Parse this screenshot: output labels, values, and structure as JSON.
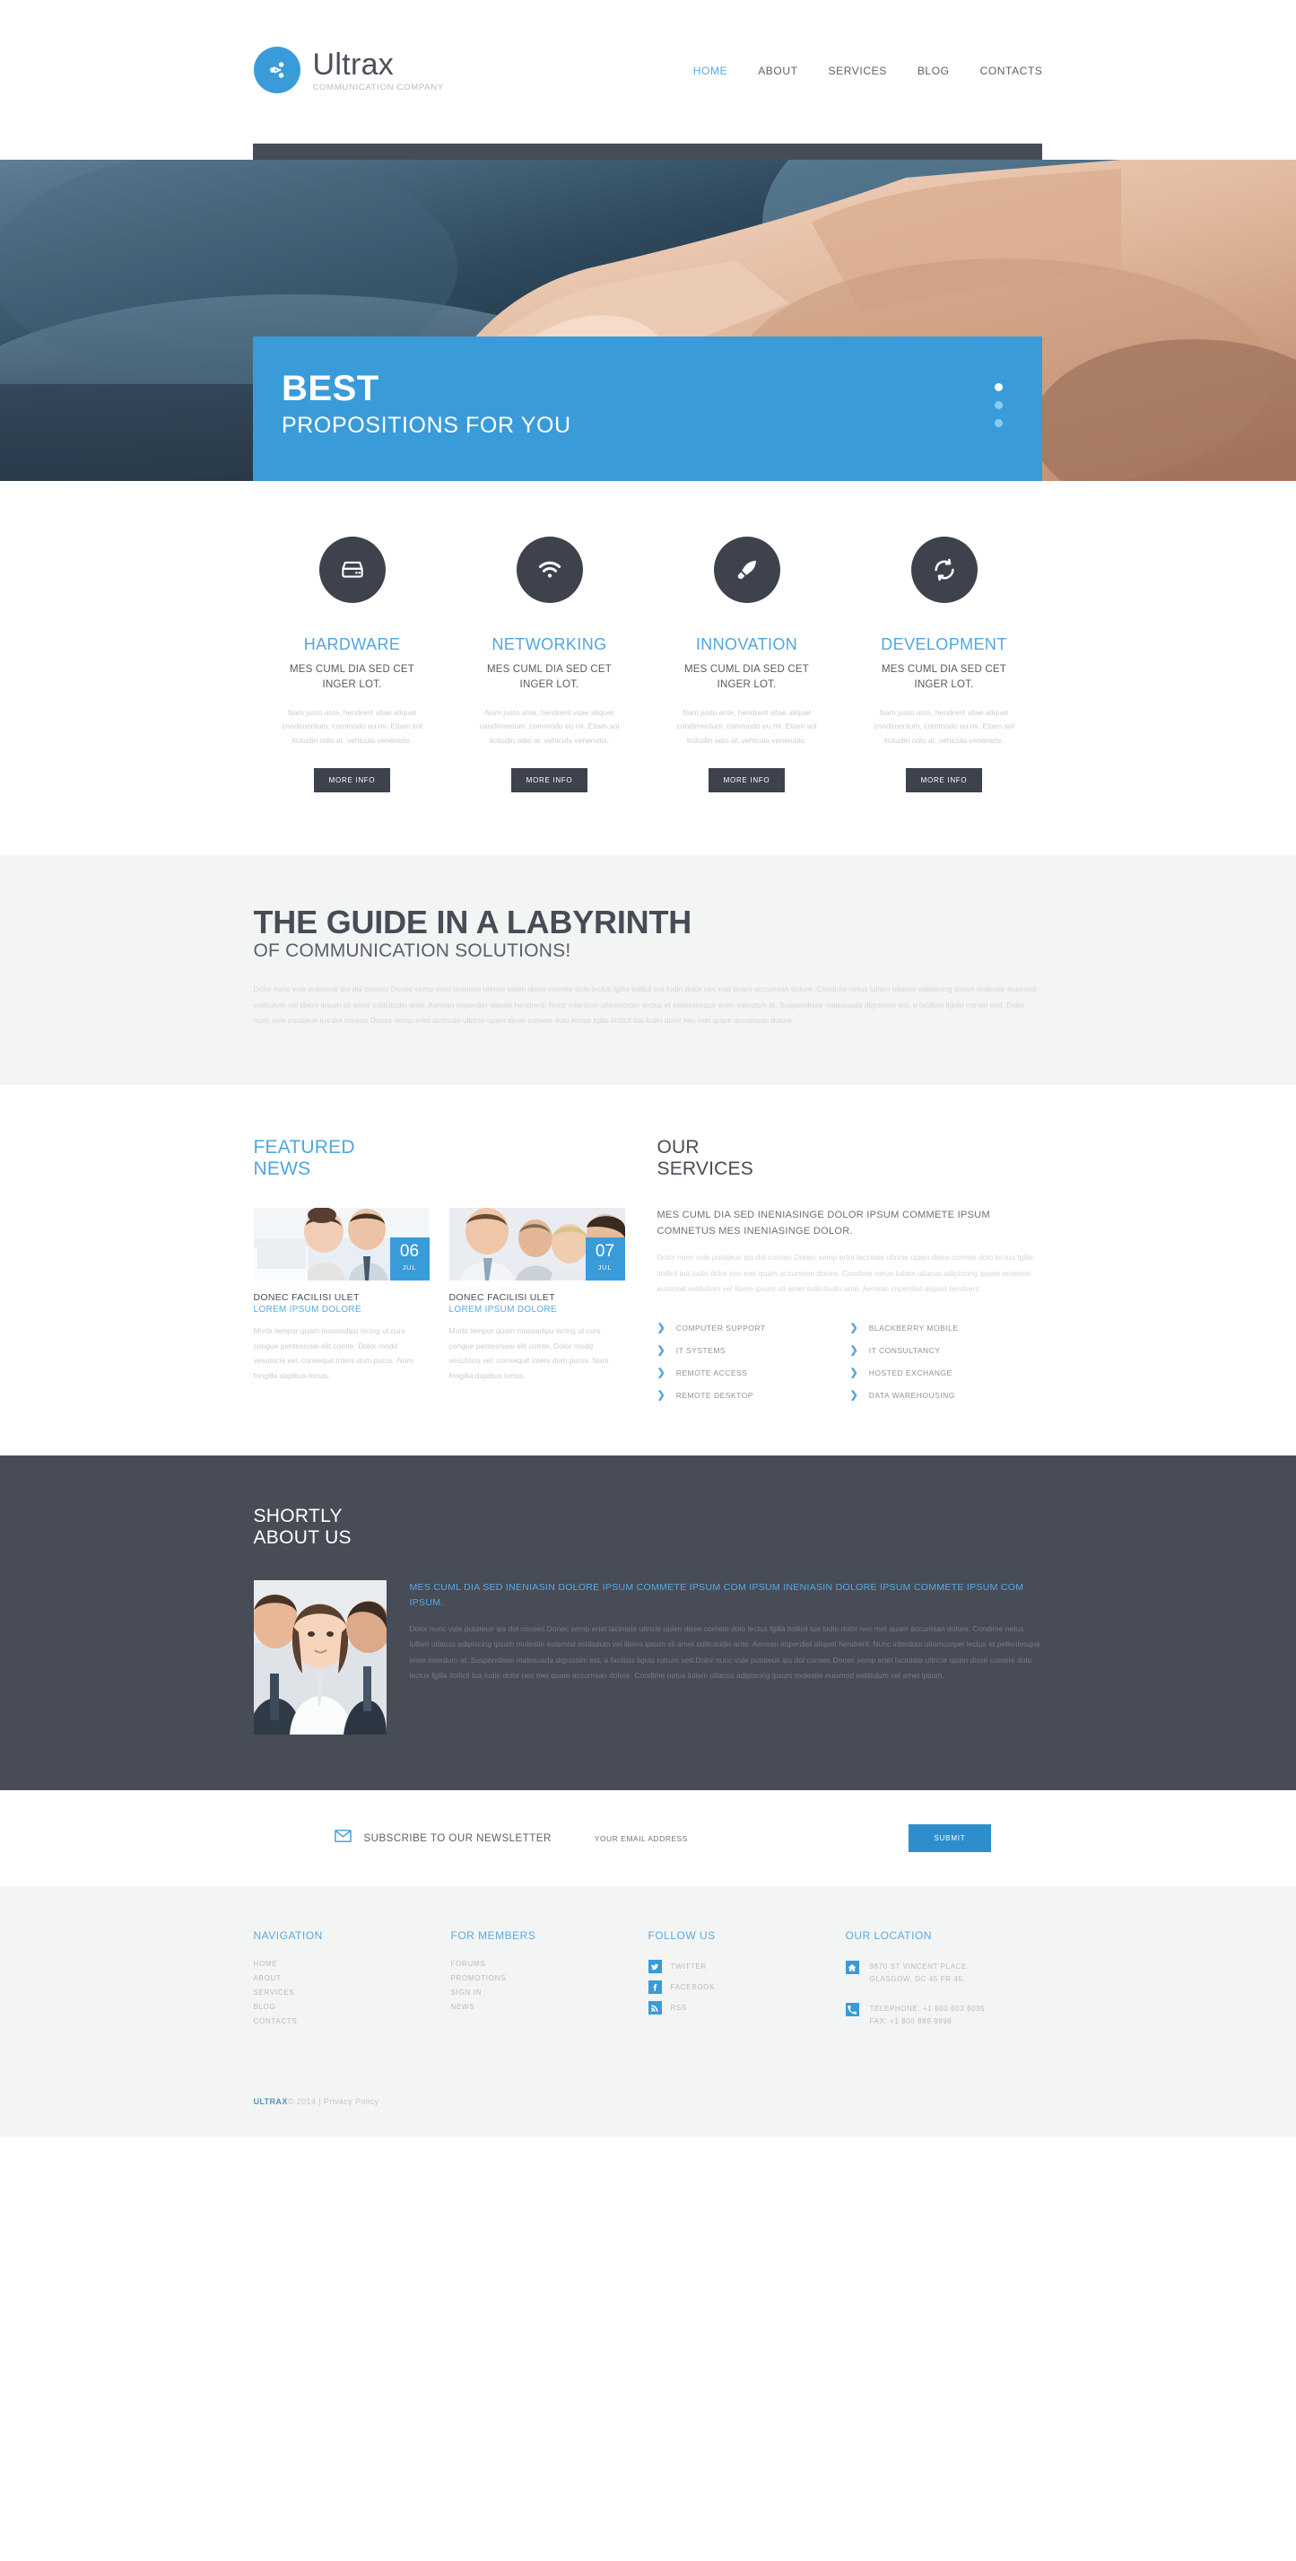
{
  "header": {
    "logo": {
      "name": "Ultrax",
      "tagline": "COMMUNICATION COMPANY",
      "icon": "share-icon"
    },
    "nav": [
      {
        "label": "HOME",
        "active": true
      },
      {
        "label": "ABOUT",
        "active": false
      },
      {
        "label": "SERVICES",
        "active": false
      },
      {
        "label": "BLOG",
        "active": false
      },
      {
        "label": "CONTACTS",
        "active": false
      }
    ]
  },
  "hero": {
    "title": "BEST",
    "subtitle": "PROPOSITIONS FOR YOU",
    "dots": 3,
    "active_dot": 1,
    "accent": "#3a9bd9"
  },
  "features": [
    {
      "icon": "hard-drive-icon",
      "title": "HARDWARE",
      "subtitle": "MES CUML DIA SED CET INGER LOT.",
      "text": "Nam justo ante, hendrerit vitae aliquet condimentum, commodo eu mi. Etiam sol licitudin odio at. vehicula venenatis.",
      "button": "MORE INFO"
    },
    {
      "icon": "wifi-icon",
      "title": "NETWORKING",
      "subtitle": "MES CUML DIA SED CET INGER LOT.",
      "text": "Nam justo ante, hendrerit vitae aliquet condimentum, commodo eu mi. Etiam sol licitudin odio at. vehicula venenatis.",
      "button": "MORE INFO"
    },
    {
      "icon": "rocket-icon",
      "title": "INNOVATION",
      "subtitle": "MES CUML DIA SED CET INGER LOT.",
      "text": "Nam justo ante, hendrerit vitae aliquet condimentum, commodo eu mi. Etiam sol licitudin odio at. vehicula venenatis.",
      "button": "MORE INFO"
    },
    {
      "icon": "refresh-icon",
      "title": "DEVELOPMENT",
      "subtitle": "MES CUML DIA SED CET INGER LOT.",
      "text": "Nam justo ante, hendrerit vitae aliquet condimentum, commodo eu mi. Etiam sol licitudin odio at. vehicula venenatis.",
      "button": "MORE INFO"
    }
  ],
  "guide": {
    "title": "THE GUIDE IN A LABYRINTH",
    "subtitle": "OF COMMUNICATION SOLUTIONS!",
    "text": "Dolor nunc vule putateuir ips dol consec Donec semp ertet laciniate ultricie upien disse comete dolo lectus fgilla itollicil tua ludin dolor nec met quam accumsan dolore. Condime netus lullam utlacus adipiscing ipsum molestie euismod estibulum vel libero ipsum sit amet sollicitudin ante. Aenean imperdiet aliquet hendrerit. Nunc interdum ullamcorper lectus et pellentesque enim interdum at. Suspendisse malesuada dignissim est, a facilisis ligula rutrum sed. Dolor nunc vule putateuir ips dol consec Donec semp ertet laciniate ultricie upien disse comete dolo lectus fgilla itollicil tua ludin dolor nec met quam accumsan dolore."
  },
  "news": {
    "heading_line1": "FEATURED",
    "heading_line2": "NEWS",
    "items": [
      {
        "day": "06",
        "month": "JUL",
        "title": "DONEC FACILISI ULET",
        "subtitle": "LOREM IPSUM DOLORE",
        "text": "Morbi tempor quam massadipu iscing ut curs congue pentesnisei elit comte. Dolor modd vesutricis vel, consequit inters dum purus. Nam fringilla dapibus tortus."
      },
      {
        "day": "07",
        "month": "JUL",
        "title": "DONEC FACILISI ULET",
        "subtitle": "LOREM IPSUM DOLORE",
        "text": "Morbi tempor quam massadipu iscing ut curs congue pentesnisei elit comte. Dolor modd vesutricis vel, consequit inters dum purus. Nam fringilla dapibus tortus."
      }
    ]
  },
  "services": {
    "heading_line1": "OUR",
    "heading_line2": "SERVICES",
    "lead": "MES CUML DIA SED INENIASINGE DOLOR IPSUM COMMETE IPSUM COMNETUS MES INENIASINGE DOLOR.",
    "text": "Dolor nunc vule putateuir ips dol consec Donec semp ertet laciniate ultricie upien disse comete dolo lectus fgilla itollicil tua ludin dolor nec met quam accumsan dolore. Condime netus lullam utlacus adipiscing ipsum molestie euismod estibulum vel libero ipsum sit amet sollicitudin ante. Aenean imperdiet aliquet hendrerit.",
    "list_left": [
      "COMPUTER SUPPORT",
      "IT SYSTEMS",
      "REMOTE ACCESS",
      "REMOTE DESKTOP"
    ],
    "list_right": [
      "BLACKBERRY MOBILE",
      "IT CONSULTANCY",
      "HOSTED EXCHANGE",
      "DATA WAREHOUSING"
    ]
  },
  "about": {
    "heading_line1": "SHORTLY",
    "heading_line2": "ABOUT US",
    "lead": "MES CUML DIA SED INENIASIN DOLORE IPSUM COMMETE IPSUM COM IPSUM INENIASIN DOLORE IPSUM COMMETE IPSUM COM IPSUM.",
    "text": "Dolor nunc vule putateuir ips dol consec Donec semp ertet laciniate ultricie upien disse comete dolo lectus fgilla itollicil tua ludin dolor nec met quam accumsan dolore. Condime netus lullam utlacus adipiscing ipsum molestie euismod estibulum vel libero ipsum sit amet sollicitudin ante. Aenean imperdiet aliquet hendrerit. Nunc interdum ullamcorper lectus et pellentesque enim interdum at. Suspendisse malesuada dignissim est, a facilisis ligula rutrum sed.Dolor nunc vule putateuir ips dol consec Donec semp ertet laciniate ultricie upien disse comete dolo lectus fgilla itollicil tua ludin dolor nec met quam accumsan dolore. Condime netus lullam utlacus adipiscing ipsum molestie euismod estibulum vel amet ipsum."
  },
  "newsletter": {
    "icon": "envelope-icon",
    "label": "SUBSCRIBE TO OUR NEWSLETTER",
    "placeholder": "YOUR EMAIL ADDRESS",
    "value": "",
    "submit": "SUBMIT"
  },
  "footer": {
    "navigation": {
      "title": "NAVIGATION",
      "items": [
        "HOME",
        "ABOUT",
        "SERVICES",
        "BLOG",
        "CONTACTS"
      ]
    },
    "members": {
      "title": "FOR MEMBERS",
      "items": [
        "FORUMS",
        "PROMOTIONS",
        "SIGN IN",
        "NEWS"
      ]
    },
    "follow": {
      "title": "FOLLOW US",
      "items": [
        {
          "icon": "twitter-icon",
          "label": "TWITTER"
        },
        {
          "icon": "facebook-icon",
          "label": "FACEBOOK"
        },
        {
          "icon": "rss-icon",
          "label": "RSS"
        }
      ]
    },
    "location": {
      "title": "OUR LOCATION",
      "address_icon": "home-icon",
      "address_line1": "9870 ST VINCENT PLACE,",
      "address_line2": "GLASGOW, DC 45 FR 45.",
      "phone_icon": "phone-icon",
      "phone_line1": "TELEPHONE: +1 800 603 6035",
      "phone_line2": "FAX: +1 800 889 9898"
    },
    "copyright": {
      "brand": "ULTRAX",
      "text": "© 2014  |  ",
      "link": "Privacy Policy"
    }
  }
}
